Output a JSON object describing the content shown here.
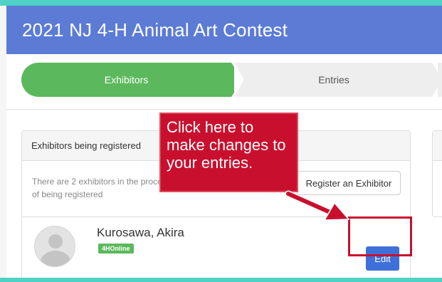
{
  "header": {
    "title": "2021 NJ 4-H Animal Art Contest"
  },
  "steps": [
    {
      "label": "Exhibitors",
      "active": true
    },
    {
      "label": "Entries",
      "active": false
    }
  ],
  "panel": {
    "heading": "Exhibitors being registered",
    "info": "There are 2 exhibitors in the process of being registered",
    "register_button": "Register an Exhibitor"
  },
  "exhibitor": {
    "name": "Kurosawa, Akira",
    "badge": "4HOnline",
    "edit_button": "Edit"
  },
  "callout": {
    "text": "Click here to make changes to your entries."
  },
  "colors": {
    "header_bg": "#5b7bd5",
    "accent_strip": "#4fd1c5",
    "active_step": "#5cb85c",
    "edit_button": "#3f6fd8",
    "callout": "#c8102e"
  }
}
